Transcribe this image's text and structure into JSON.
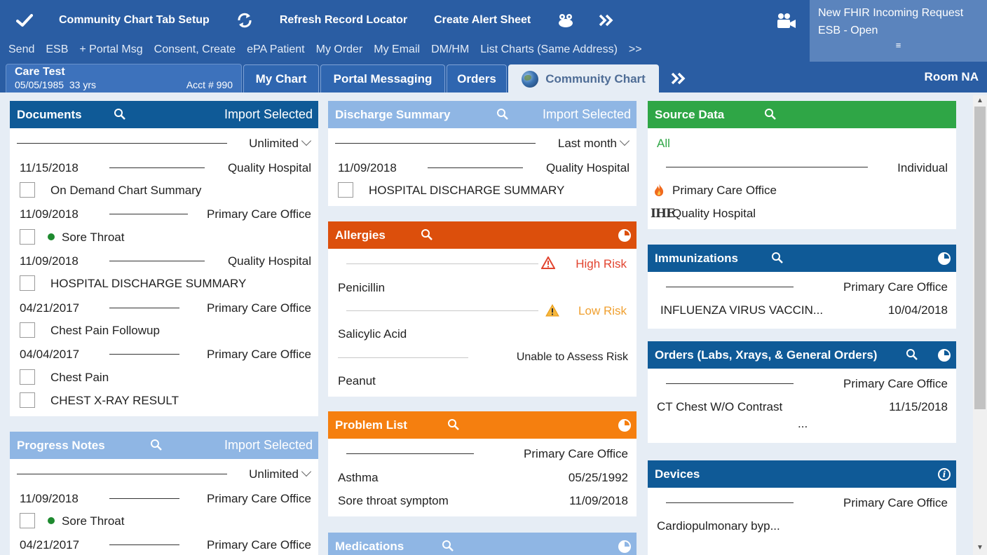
{
  "toolbar": {
    "items": [
      {
        "label": "Community Chart Tab Setup"
      },
      {
        "label": "Refresh Record Locator"
      },
      {
        "label": "Create Alert Sheet"
      }
    ],
    "row2": [
      "Send",
      "ESB",
      "+ Portal Msg",
      "Consent, Create",
      "ePA Patient",
      "My Order",
      "My Email",
      "DM/HM",
      "List Charts (Same Address)",
      ">>"
    ],
    "notifications": {
      "line1": "New FHIR Incoming Request",
      "line2": "ESB - Open",
      "menu": "≡"
    }
  },
  "patient": {
    "name": "Care Test",
    "dob": "05/05/1985",
    "age": "33 yrs",
    "acct": "Acct # 990"
  },
  "tabs": [
    {
      "label": "My Chart"
    },
    {
      "label": "Portal Messaging"
    },
    {
      "label": "Orders"
    },
    {
      "label": "Community Chart"
    }
  ],
  "room": "Room NA",
  "documents": {
    "title": "Documents",
    "import": "Import Selected",
    "filter": "Unlimited",
    "groups": [
      {
        "date": "11/15/2018",
        "source": "Quality Hospital",
        "items": [
          "On Demand Chart Summary"
        ]
      },
      {
        "date": "11/09/2018",
        "source": "Primary Care Office",
        "items": [
          "Sore Throat"
        ]
      },
      {
        "date": "11/09/2018",
        "source": "Quality Hospital",
        "items": [
          "HOSPITAL DISCHARGE SUMMARY"
        ]
      },
      {
        "date": "04/21/2017",
        "source": "Primary Care Office",
        "items": [
          "Chest Pain Followup"
        ]
      },
      {
        "date": "04/04/2017",
        "source": "Primary Care Office",
        "items": [
          "Chest Pain",
          "CHEST X-RAY RESULT"
        ]
      }
    ]
  },
  "progress": {
    "title": "Progress Notes",
    "import": "Import Selected",
    "filter": "Unlimited",
    "groups": [
      {
        "date": "11/09/2018",
        "source": "Primary Care Office",
        "items": [
          "Sore Throat"
        ]
      },
      {
        "date": "04/21/2017",
        "source": "Primary Care Office",
        "items": []
      }
    ]
  },
  "discharge": {
    "title": "Discharge Summary",
    "import": "Import Selected",
    "filter": "Last month",
    "date": "11/09/2018",
    "source": "Quality Hospital",
    "item": "HOSPITAL DISCHARGE SUMMARY"
  },
  "allergies": {
    "title": "Allergies",
    "groups": [
      {
        "risk": "High Risk",
        "item": "Penicillin",
        "color": "#e2442f"
      },
      {
        "risk": "Low Risk",
        "item": "Salicylic Acid",
        "color": "#f0a030"
      },
      {
        "risk": "Unable to Assess Risk",
        "item": "Peanut",
        "color": "#222222"
      }
    ]
  },
  "problems": {
    "title": "Problem List",
    "source": "Primary Care Office",
    "items": [
      {
        "name": "Asthma",
        "date": "05/25/1992"
      },
      {
        "name": "Sore throat symptom",
        "date": "11/09/2018"
      }
    ]
  },
  "medications": {
    "title": "Medications"
  },
  "source_data": {
    "title": "Source Data",
    "all": "All",
    "individual": "Individual",
    "sources": [
      "Primary Care Office",
      "Quality Hospital"
    ],
    "ihe": "IHE"
  },
  "immunizations": {
    "title": "Immunizations",
    "source": "Primary Care Office",
    "item": "INFLUENZA VIRUS VACCIN...",
    "date": "10/04/2018"
  },
  "orders": {
    "title": "Orders (Labs, Xrays, & General Orders)",
    "source": "Primary Care Office",
    "item": "CT Chest W/O Contrast",
    "date": "11/15/2018",
    "more": "..."
  },
  "devices": {
    "title": "Devices",
    "source": "Primary Care Office",
    "item": "Cardiopulmonary byp..."
  },
  "colors": {
    "toolbar": "#2a5da3",
    "header_blue": "#0f5a97",
    "header_lightblue": "#8fb6e4",
    "header_green": "#2fa646",
    "header_red": "#dc4f0c",
    "header_orange": "#f57f0f"
  }
}
